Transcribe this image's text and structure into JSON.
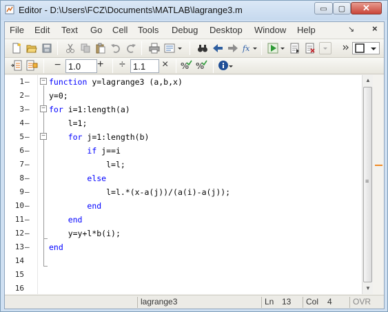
{
  "window": {
    "title": "Editor - D:\\Users\\FCZ\\Documents\\MATLAB\\lagrange3.m",
    "min_glyph": "▭",
    "max_glyph": "▢",
    "close_glyph": "✕"
  },
  "menubar": {
    "items": [
      "File",
      "Edit",
      "Text",
      "Go",
      "Cell",
      "Tools",
      "Debug",
      "Desktop",
      "Window",
      "Help"
    ],
    "dock_glyph": "↘",
    "close_glyph": "×"
  },
  "toolbar2": {
    "minus": "−",
    "value1": "1.0",
    "plus": "+",
    "divide": "÷",
    "value2": "1.1",
    "times": "×",
    "fx_label": "fx"
  },
  "editor": {
    "line_numbers": [
      "1",
      "2",
      "3",
      "4",
      "5",
      "6",
      "7",
      "8",
      "9",
      "10",
      "11",
      "12",
      "13",
      "14",
      "15",
      "16"
    ],
    "dash": "–",
    "lines": [
      {
        "indent": "",
        "kw": "function",
        "text": " y=lagrange3 (a,b,x)"
      },
      {
        "indent": "",
        "kw": "",
        "text": "y=0;"
      },
      {
        "indent": "",
        "kw": "for",
        "text": " i=1:length(a)"
      },
      {
        "indent": "    ",
        "kw": "",
        "text": "l=1;"
      },
      {
        "indent": "    ",
        "kw": "for",
        "text": " j=1:length(b)"
      },
      {
        "indent": "        ",
        "kw": "if",
        "text": " j==i"
      },
      {
        "indent": "            ",
        "kw": "",
        "text": "l=l;"
      },
      {
        "indent": "        ",
        "kw": "else",
        "text": ""
      },
      {
        "indent": "            ",
        "kw": "",
        "text": "l=l.*(x-a(j))/(a(i)-a(j));"
      },
      {
        "indent": "        ",
        "kw": "end",
        "text": ""
      },
      {
        "indent": "    ",
        "kw": "end",
        "text": ""
      },
      {
        "indent": "    ",
        "kw": "",
        "text": "y=y+l*b(i);"
      },
      {
        "indent": "",
        "kw": "end",
        "text": ""
      },
      {
        "indent": "",
        "kw": "",
        "text": ""
      },
      {
        "indent": "",
        "kw": "",
        "text": ""
      },
      {
        "indent": "",
        "kw": "",
        "text": ""
      }
    ],
    "keyword_color": "#0000ff",
    "marker_color": "#f08a24"
  },
  "statusbar": {
    "filename": "lagrange3",
    "ln_label": "Ln",
    "ln_value": "13",
    "col_label": "Col",
    "col_value": "4",
    "mode": "OVR"
  }
}
